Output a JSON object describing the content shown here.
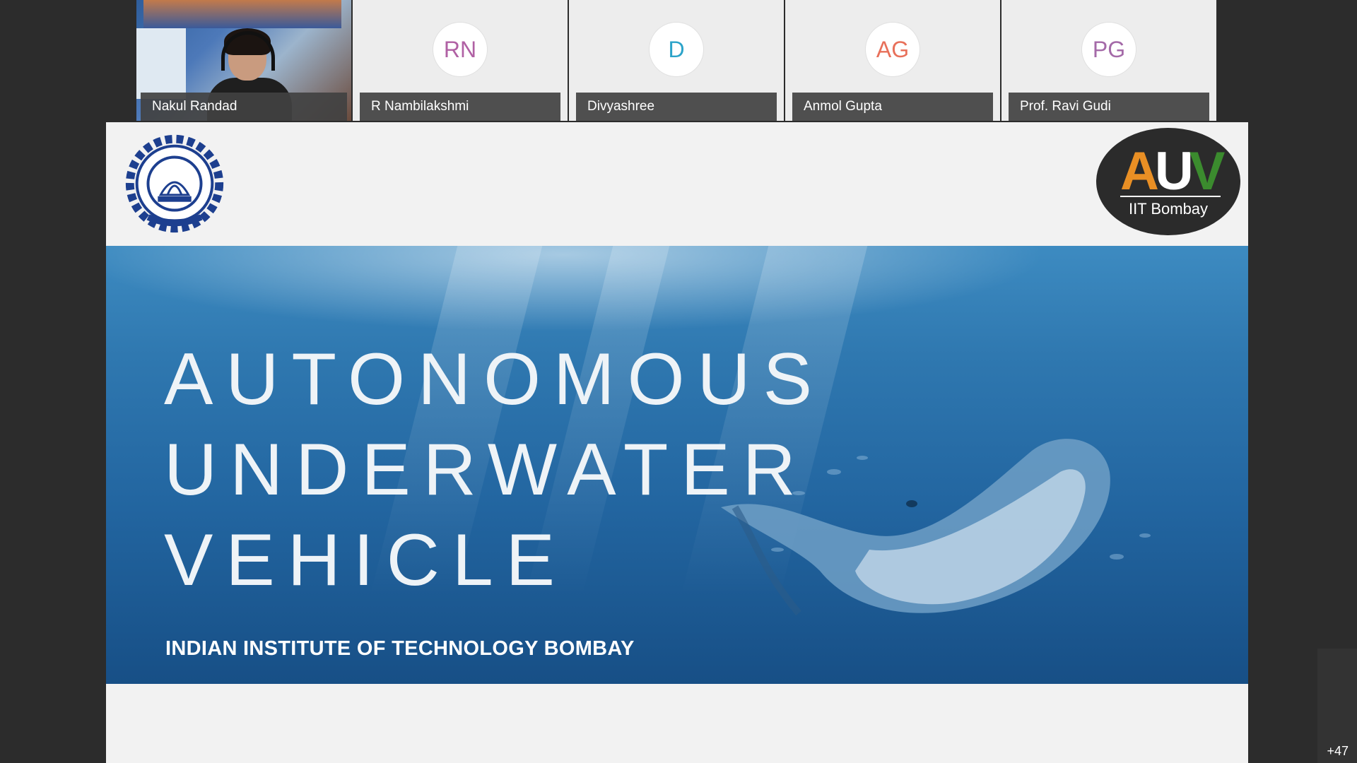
{
  "participants": [
    {
      "name": "Nakul Randad",
      "type": "video"
    },
    {
      "name": "R Nambilakshmi",
      "initials": "RN",
      "color": "#b061a4"
    },
    {
      "name": "Divyashree",
      "initials": "D",
      "color": "#2ba3c9"
    },
    {
      "name": "Anmol Gupta",
      "initials": "AG",
      "color": "#e8705a"
    },
    {
      "name": "Prof. Ravi Gudi",
      "initials": "PG",
      "color": "#a46aa8"
    }
  ],
  "slide": {
    "title_lines": [
      "AUTONOMOUS",
      "UNDERWATER",
      "VEHICLE"
    ],
    "subtitle": "INDIAN INSTITUTE OF TECHNOLOGY BOMBAY",
    "logo_right": {
      "letters": [
        "A",
        "U",
        "V"
      ],
      "sub": "IIT Bombay"
    },
    "logo_left_text": "INDIAN INSTITUTE OF TECHNOLOGY BOMBAY"
  },
  "more_participants": "+47"
}
